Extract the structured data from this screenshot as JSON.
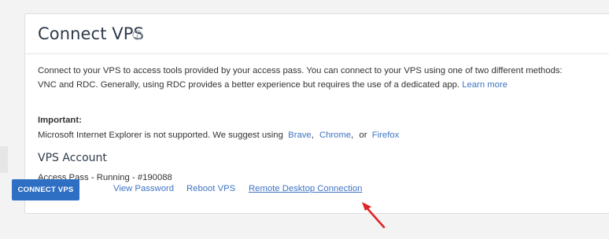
{
  "card": {
    "title": "Connect VPS",
    "title_icon": "info-circle-icon"
  },
  "intro": {
    "line1": "Connect to your VPS to access tools provided by your access pass. You can connect to your VPS using one of two different methods:",
    "line2": "VNC and RDC. Generally, using RDC provides a better experience but requires the use of a dedicated app.",
    "learn_more": "Learn more"
  },
  "important": {
    "label": "Important:",
    "text": "Microsoft Internet Explorer is not supported. We suggest using",
    "browsers": [
      "Brave",
      "Chrome",
      "Firefox"
    ],
    "separator": ",",
    "or": "or"
  },
  "account": {
    "title": "VPS Account",
    "status": "Access Pass - Running - #190088"
  },
  "actions": {
    "connect": "CONNECT VPS",
    "view_password": "View Password",
    "reboot": "Reboot VPS",
    "rdc": "Remote Desktop Connection"
  },
  "annotation": {
    "arrow_icon": "red-arrow-icon",
    "arrow_color": "#e02424"
  },
  "colors": {
    "accent": "#2f6fc3",
    "link": "#3f74c4"
  }
}
